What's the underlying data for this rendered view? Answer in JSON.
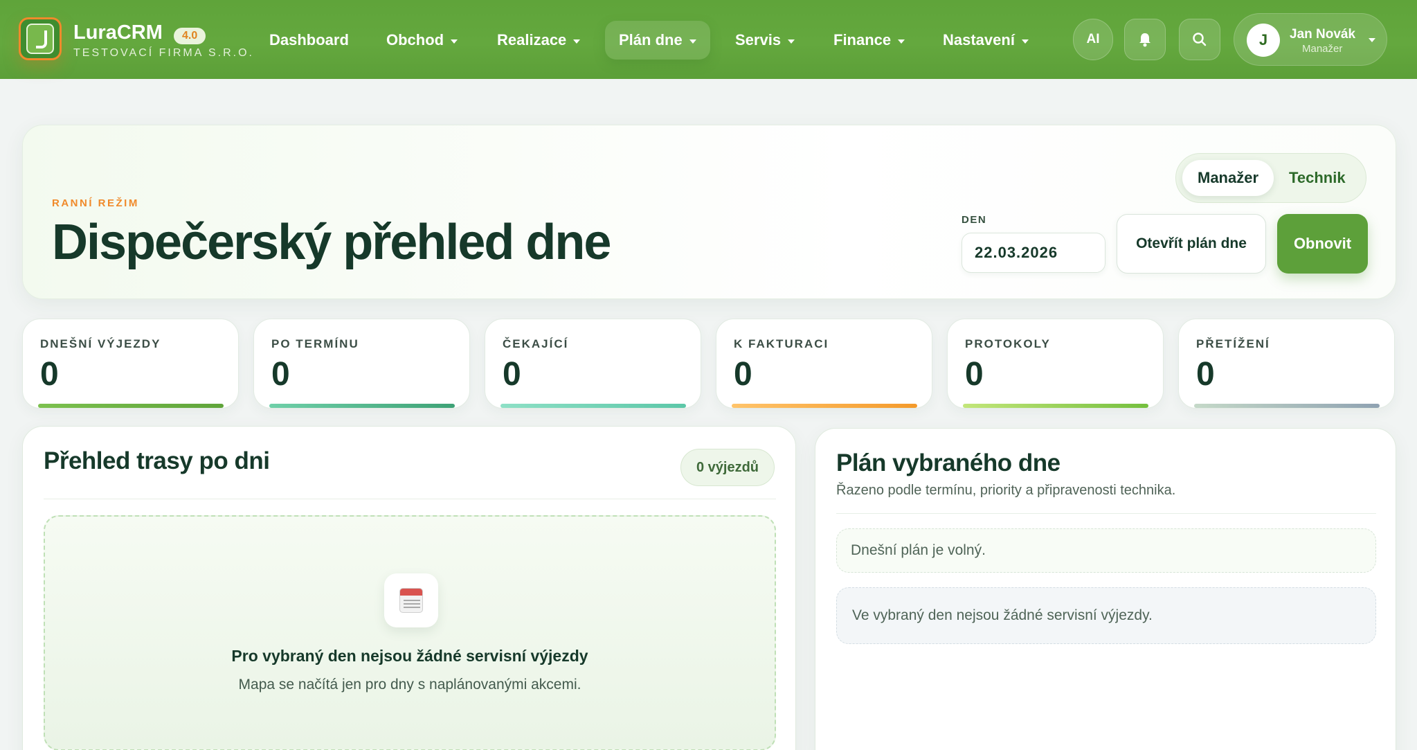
{
  "brand": {
    "name": "LuraCRM",
    "version": "4.0",
    "company": "TESTOVACÍ FIRMA S.R.O."
  },
  "nav": {
    "items": [
      {
        "label": "Dashboard",
        "has_menu": false
      },
      {
        "label": "Obchod",
        "has_menu": true
      },
      {
        "label": "Realizace",
        "has_menu": true
      },
      {
        "label": "Plán dne",
        "has_menu": true,
        "active": true
      },
      {
        "label": "Servis",
        "has_menu": true
      },
      {
        "label": "Finance",
        "has_menu": true
      },
      {
        "label": "Nastavení",
        "has_menu": true
      }
    ],
    "ai_label": "AI",
    "user": {
      "initial": "J",
      "name": "Jan Novák",
      "role": "Manažer"
    }
  },
  "hero": {
    "eyebrow": "RANNÍ REŽIM",
    "title": "Dispečerský přehled dne",
    "role_toggle": [
      "Manažer",
      "Technik"
    ],
    "role_active": "Manažer",
    "date_label": "DEN",
    "date_value": "22.03.2026",
    "open_plan_label": "Otevřít plán dne",
    "refresh_label": "Obnovit"
  },
  "stats": [
    {
      "label": "DNEŠNÍ VÝJEZDY",
      "value": "0",
      "bar_from": "#7cc14f",
      "bar_to": "#5fa43a"
    },
    {
      "label": "PO TERMÍNU",
      "value": "0",
      "bar_from": "#6fd0a9",
      "bar_to": "#3ea276"
    },
    {
      "label": "ČEKAJÍCÍ",
      "value": "0",
      "bar_from": "#8ee0c6",
      "bar_to": "#5cc7a8"
    },
    {
      "label": "K FAKTURACI",
      "value": "0",
      "bar_from": "#ffc46b",
      "bar_to": "#f49a2b"
    },
    {
      "label": "PROTOKOLY",
      "value": "0",
      "bar_from": "#c3e67a",
      "bar_to": "#74bf3e"
    },
    {
      "label": "PŘETÍŽENÍ",
      "value": "0",
      "bar_from": "#c5d9c8",
      "bar_to": "#8fa2b2"
    }
  ],
  "route": {
    "title": "Přehled trasy po dni",
    "count_badge": "0 výjezdů",
    "empty_title": "Pro vybraný den nejsou žádné servisní výjezdy",
    "empty_sub": "Mapa se načítá jen pro dny s naplánovanými akcemi.",
    "empty_icon": "calendar-icon"
  },
  "plan": {
    "title": "Plán vybraného dne",
    "subtitle": "Řazeno podle termínu, priority a připravenosti technika.",
    "note_free": "Dnešní plán je volný.",
    "note_none": "Ve vybraný den nejsou žádné servisní výjezdy."
  }
}
